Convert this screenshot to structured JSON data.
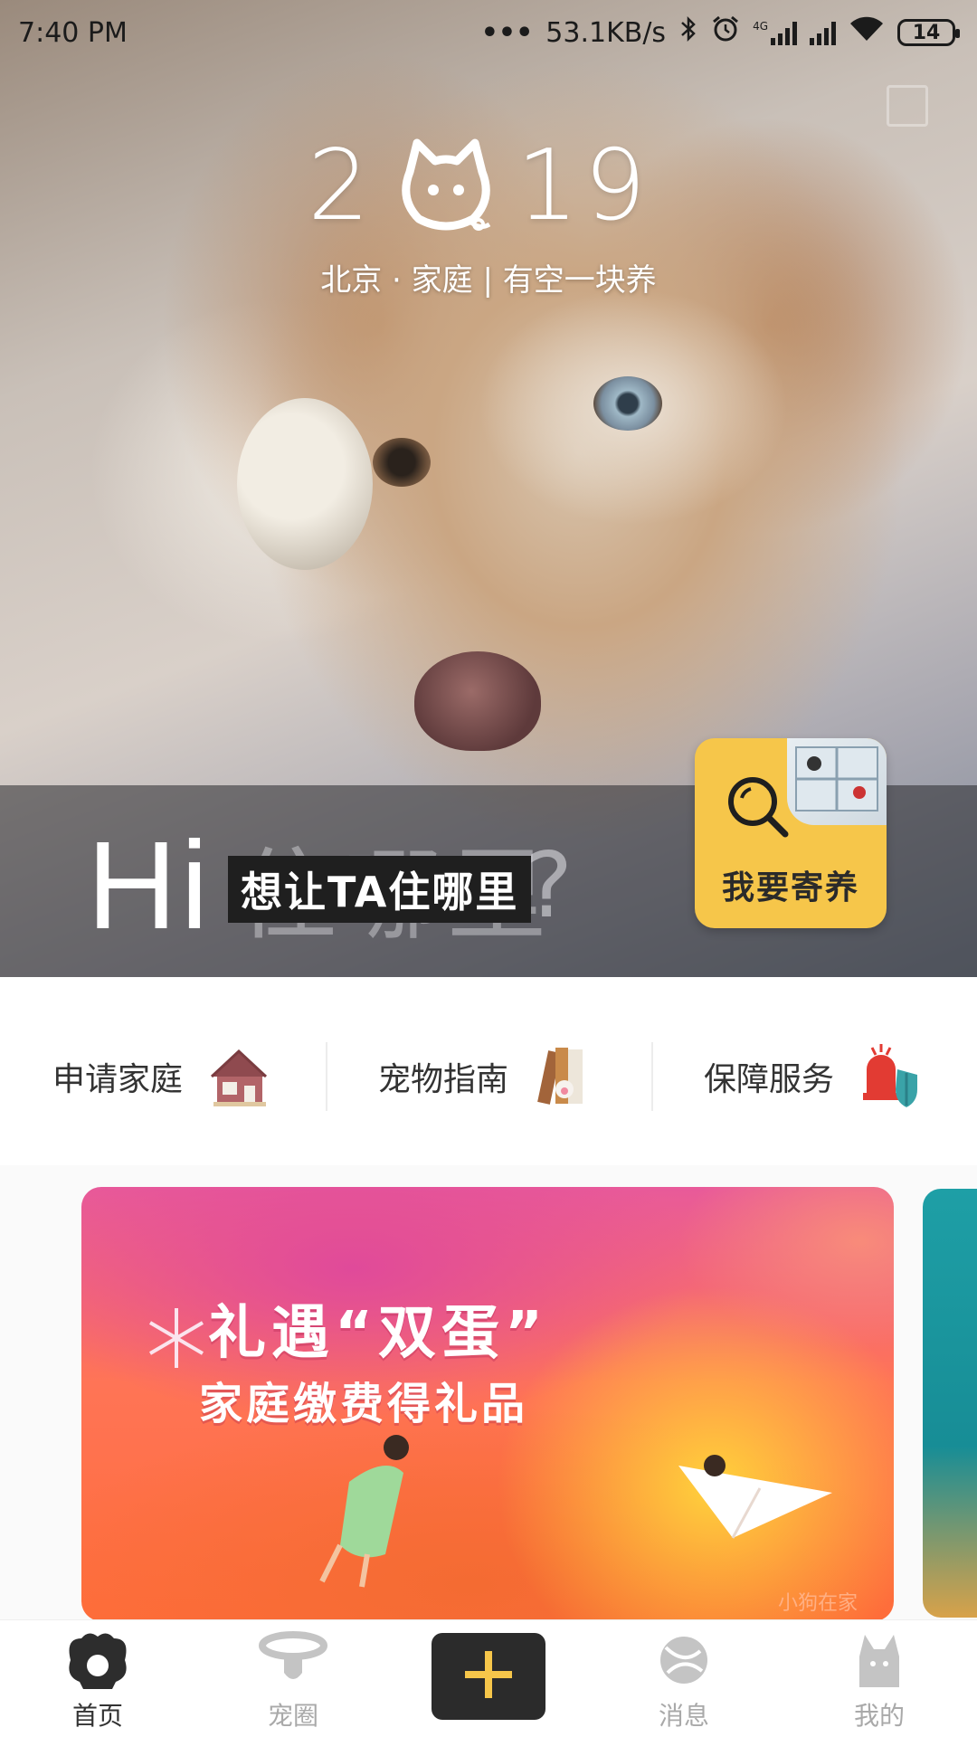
{
  "status_bar": {
    "time": "7:40 PM",
    "network_speed": "53.1KB/s",
    "network_type": "4G",
    "battery_level": "14"
  },
  "hero": {
    "year_left": "2",
    "year_right": "19",
    "tagline": "北京 · 家庭 | 有空一块养",
    "hi_text": "Hi",
    "hi_background_text": "住哪里",
    "hi_question_mark": "?",
    "hi_label": "想让TA住哪里",
    "foster_button_label": "我要寄养"
  },
  "quick_entries": [
    {
      "label": "申请家庭",
      "icon": "house-icon"
    },
    {
      "label": "宠物指南",
      "icon": "guide-book-icon"
    },
    {
      "label": "保障服务",
      "icon": "shield-alarm-icon"
    }
  ],
  "banner": {
    "title_line1": "礼遇“双蛋”",
    "title_line2": "家庭缴费得礼品",
    "brand_text": "小狗在家"
  },
  "tab_bar": {
    "tabs": [
      {
        "label": "首页",
        "icon": "home-dog-icon",
        "active": true
      },
      {
        "label": "宠圈",
        "icon": "pet-collar-icon",
        "active": false
      },
      {
        "label": "",
        "icon": "plus-icon",
        "active": false
      },
      {
        "label": "消息",
        "icon": "message-ball-icon",
        "active": false
      },
      {
        "label": "我的",
        "icon": "profile-pet-icon",
        "active": false
      }
    ]
  },
  "colors": {
    "accent_yellow": "#f6c64a",
    "tab_active": "#333333",
    "tab_inactive": "#a9a9a9",
    "plus_button_bg": "#2b2b2b",
    "plus_sign": "#f6c64a"
  }
}
